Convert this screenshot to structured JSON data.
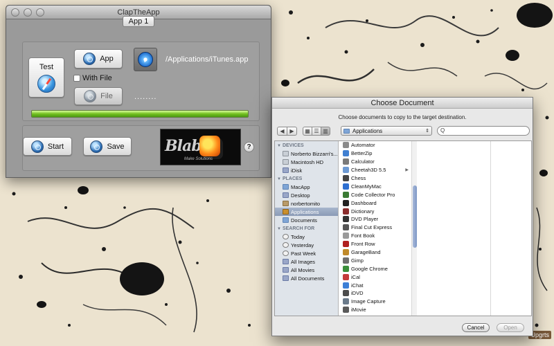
{
  "desktop": {
    "corner_label": "Upgrts"
  },
  "clap_window": {
    "title": "ClapTheApp",
    "tab_label": "App 1",
    "test_button_label": "Test",
    "app_button_label": "App",
    "with_file_label": "With File",
    "file_button_label": "File",
    "app_path": "/Applications/iTunes.app",
    "file_path": "........",
    "progress_percent": 100,
    "start_button_label": "Start",
    "save_button_label": "Save",
    "help_label": "?",
    "logo_text": "Blab",
    "logo_subtext": "Make Solutions"
  },
  "doc_window": {
    "title": "Choose Document",
    "prompt": "Choose documents to copy to the target destination.",
    "location": "Applications",
    "search_placeholder": "Q",
    "sidebar": {
      "devices_heading": "DEVICES",
      "devices": [
        {
          "label": "Norberto Bizzarri's...",
          "icon": "computer-icon"
        },
        {
          "label": "Macintosh HD",
          "icon": "hard-disk-icon"
        },
        {
          "label": "iDisk",
          "icon": "idisk-icon"
        }
      ],
      "places_heading": "PLACES",
      "places": [
        {
          "label": "MacApp",
          "icon": "folder-icon"
        },
        {
          "label": "Desktop",
          "icon": "desktop-icon"
        },
        {
          "label": "norbertomito",
          "icon": "home-icon"
        },
        {
          "label": "Applications",
          "icon": "applications-icon",
          "selected": true
        },
        {
          "label": "Documents",
          "icon": "folder-icon"
        }
      ],
      "search_heading": "SEARCH FOR",
      "searches": [
        {
          "label": "Today",
          "icon": "clock-icon"
        },
        {
          "label": "Yesterday",
          "icon": "clock-icon"
        },
        {
          "label": "Past Week",
          "icon": "clock-icon"
        },
        {
          "label": "All Images",
          "icon": "smart-folder-icon"
        },
        {
          "label": "All Movies",
          "icon": "smart-folder-icon"
        },
        {
          "label": "All Documents",
          "icon": "smart-folder-icon"
        }
      ]
    },
    "files": [
      {
        "label": "Automator",
        "color": "#8a8a8a"
      },
      {
        "label": "BetterZip",
        "color": "#3f7fd1"
      },
      {
        "label": "Calculator",
        "color": "#7a7a7a"
      },
      {
        "label": "Cheetah3D 5.5",
        "color": "#6d9ad3",
        "folder": true
      },
      {
        "label": "Chess",
        "color": "#444444"
      },
      {
        "label": "CleanMyMac",
        "color": "#2e6fd0"
      },
      {
        "label": "Code Collector Pro",
        "color": "#3a7b33"
      },
      {
        "label": "Dashboard",
        "color": "#222222"
      },
      {
        "label": "Dictionary",
        "color": "#8b2d2d"
      },
      {
        "label": "DVD Player",
        "color": "#333333"
      },
      {
        "label": "Final Cut Express",
        "color": "#555555"
      },
      {
        "label": "Font Book",
        "color": "#9a9a9a"
      },
      {
        "label": "Front Row",
        "color": "#b01f1f"
      },
      {
        "label": "GarageBand",
        "color": "#c08a2a"
      },
      {
        "label": "Gimp",
        "color": "#6f6f6f"
      },
      {
        "label": "Google Chrome",
        "color": "#3b8f3b"
      },
      {
        "label": "iCal",
        "color": "#c43b3b"
      },
      {
        "label": "iChat",
        "color": "#3d7fd6"
      },
      {
        "label": "iDVD",
        "color": "#4c4c4c"
      },
      {
        "label": "Image Capture",
        "color": "#6a7a8a"
      },
      {
        "label": "iMovie",
        "color": "#5a5a5a"
      }
    ],
    "cancel_label": "Cancel",
    "open_label": "Open"
  }
}
